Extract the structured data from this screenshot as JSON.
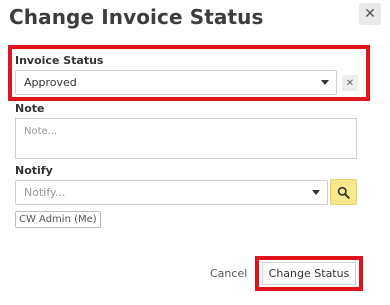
{
  "dialog": {
    "title": "Change Invoice Status",
    "close_icon": "close-icon"
  },
  "invoice_status": {
    "label": "Invoice Status",
    "selected_value": "Approved",
    "clear_icon": "clear-icon"
  },
  "note": {
    "label": "Note",
    "placeholder": "Note..."
  },
  "notify": {
    "label": "Notify",
    "placeholder": "Notify...",
    "search_icon": "search-icon",
    "selected_tags": [
      "CW Admin (Me)"
    ]
  },
  "footer": {
    "cancel_label": "Cancel",
    "submit_label": "Change Status"
  },
  "colors": {
    "highlight": "#e0151b",
    "search_button": "#f5e98c"
  }
}
